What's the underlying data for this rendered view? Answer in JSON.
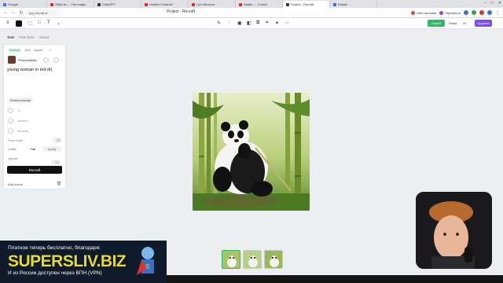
{
  "browser": {
    "tabs": [
      {
        "label": "Google",
        "icon": "google-icon"
      },
      {
        "label": "Stitch ai — The magic",
        "icon": "youtube-icon"
      },
      {
        "label": "ChatGPT",
        "icon": "notion-icon"
      },
      {
        "label": "Untitled Channel",
        "icon": "youtube-icon"
      },
      {
        "label": "Гугл Каталог",
        "icon": "youtube-icon"
      },
      {
        "label": "Stable — Cousin",
        "icon": "youtube-icon"
      },
      {
        "label": "Project - Recraft",
        "icon": "recraft-icon"
      },
      {
        "label": "Новая",
        "icon": "tab-icon"
      }
    ],
    "url": "app.recraft.ai",
    "page_title": "Project - Recraft",
    "extensions": [
      {
        "label": "Ultra translate"
      },
      {
        "label": "Перевести"
      }
    ]
  },
  "toolbar": {
    "export_label": "Export",
    "share_label": "Share",
    "credits_label": "50",
    "upgrade_label": "Upgrade"
  },
  "panel": {
    "tabs": [
      "Task",
      "Free form",
      "Vector"
    ],
    "chips": [
      "Realistic",
      "1024",
      "Square"
    ],
    "style_name": "Photorealistic",
    "prompt": "young woman in red dr|",
    "extend_label": "Extend prompt",
    "row1": "1:1",
    "row2": "Variation",
    "row3": "Similarity",
    "row4": "Negative",
    "mode_label": "Photo mode",
    "detail_label": "Quality",
    "seg": [
      "Fast",
      "Quality"
    ],
    "highres_label": "Upscale",
    "recraft_label": "Recraft",
    "add_colors_label": "Add colors"
  },
  "banner": {
    "line1": "Платное теперь бесплатно, благодаря:",
    "line2": "SUPERSLIV.BIZ",
    "line3": "И из России доступен через ВПН (VPN)"
  },
  "colors": {
    "accent_green": "#2dbb6b",
    "upgrade_purple": "#7c4dff",
    "banner_yellow": "#e8dc2a"
  }
}
